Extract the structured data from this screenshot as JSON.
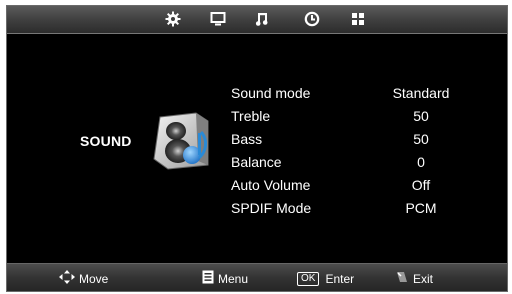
{
  "tabs": [
    {
      "icon": "gear-icon",
      "active": true
    },
    {
      "icon": "monitor-icon",
      "active": false
    },
    {
      "icon": "music-note-icon",
      "active": false
    },
    {
      "icon": "clock-icon",
      "active": false
    },
    {
      "icon": "grid-icon",
      "active": false
    }
  ],
  "section": {
    "title": "SOUND",
    "icon": "speaker-icon"
  },
  "menu": {
    "items": [
      {
        "label": "Sound mode",
        "value": "Standard"
      },
      {
        "label": "Treble",
        "value": "50"
      },
      {
        "label": "Bass",
        "value": "50"
      },
      {
        "label": "Balance",
        "value": "0"
      },
      {
        "label": "Auto Volume",
        "value": "Off"
      },
      {
        "label": "SPDIF Mode",
        "value": "PCM"
      }
    ]
  },
  "footer": {
    "move": "Move",
    "menu": "Menu",
    "ok_key": "OK",
    "enter": "Enter",
    "exit": "Exit"
  },
  "colors": {
    "background": "#000000",
    "bar": "#3e3e3e",
    "text": "#ffffff",
    "accent": "#2a8ad6"
  }
}
